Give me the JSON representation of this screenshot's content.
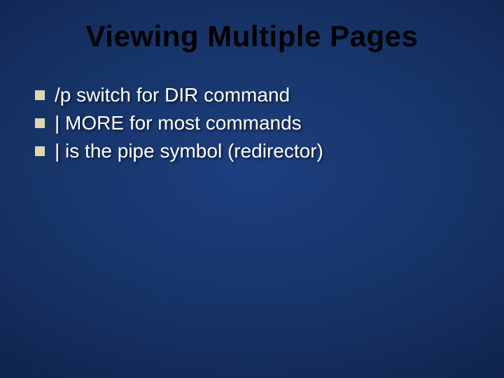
{
  "slide": {
    "title": "Viewing Multiple Pages",
    "bullets": [
      "/p switch for DIR command",
      "| MORE for most commands",
      "| is the pipe symbol (redirector)"
    ]
  }
}
